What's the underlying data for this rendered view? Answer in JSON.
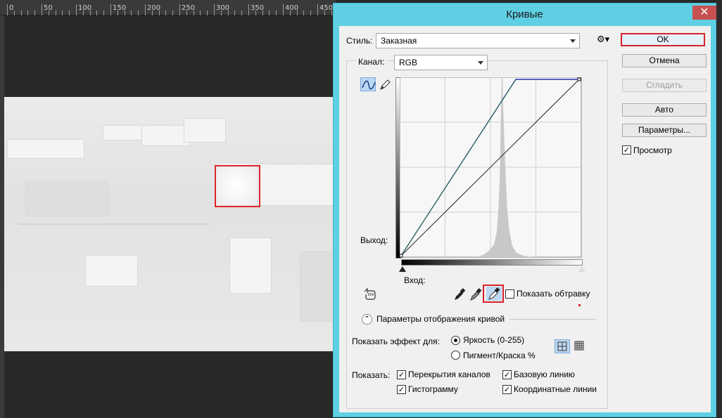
{
  "ruler": {
    "labels": [
      "0",
      "50",
      "100",
      "150",
      "200",
      "250",
      "300",
      "350",
      "400",
      "450"
    ]
  },
  "dialog": {
    "title": "Кривые",
    "close_glyph": "✕",
    "style_label": "Стиль:",
    "style_value": "Заказная",
    "channel_label": "Канал:",
    "channel_value": "RGB",
    "output_label": "Выход:",
    "input_label": "Вход:",
    "show_clipping_label": "Показать обтравку",
    "curve_options_label": "Параметры отображения кривой",
    "show_amount_label": "Показать эффект для:",
    "light_option": "Яркость (0-255)",
    "pigment_option": "Пигмент/Краска %",
    "show_label": "Показать:",
    "show_checks": {
      "channel_overlays": "Перекрытия каналов",
      "baseline": "Базовую линию",
      "histogram": "Гистограмму",
      "intersection": "Координатные линии"
    },
    "buttons": {
      "ok": "OK",
      "cancel": "Отмена",
      "smooth": "Сгладить",
      "auto": "Авто",
      "options": "Параметры..."
    },
    "preview_label": "Просмотр",
    "check_glyph": "✓",
    "chevron_glyph": "⌃",
    "gear_glyph": "⚙",
    "accent_color": "#5fd0e4",
    "highlight_color": "#d8232a"
  }
}
